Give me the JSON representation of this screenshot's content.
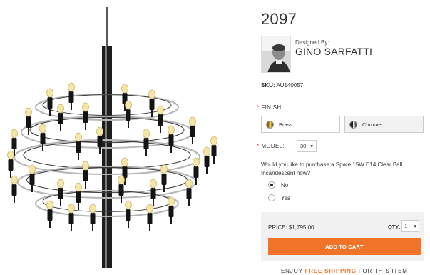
{
  "product": {
    "title": "2097",
    "designer_label": "Designed By:",
    "designer_name": "GINO SARFATTI",
    "sku_label": "SKU:",
    "sku_value": "AU140057"
  },
  "finish": {
    "label": "FINISH:",
    "options": [
      "Brass",
      "Chrome"
    ]
  },
  "model": {
    "label": "MODEL:",
    "selected": "30"
  },
  "spare_bulb": {
    "question": "Would you like to purchase a Spare 15W E14 Clear Ball Incandescent now?",
    "options": [
      "No",
      "Yes"
    ],
    "selected": "No"
  },
  "cart": {
    "price": "PRICE: $1,795.00",
    "qty_label": "QTY:",
    "qty_value": "1",
    "button_label": "ADD TO CART"
  },
  "shipping": {
    "prefix": "ENJOY ",
    "highlight": "FREE SHIPPING",
    "suffix": " FOR THIS ITEM"
  },
  "colors": {
    "accent": "#f07328",
    "required": "#e53b2c"
  },
  "icons": {
    "select_caret": "▾"
  }
}
